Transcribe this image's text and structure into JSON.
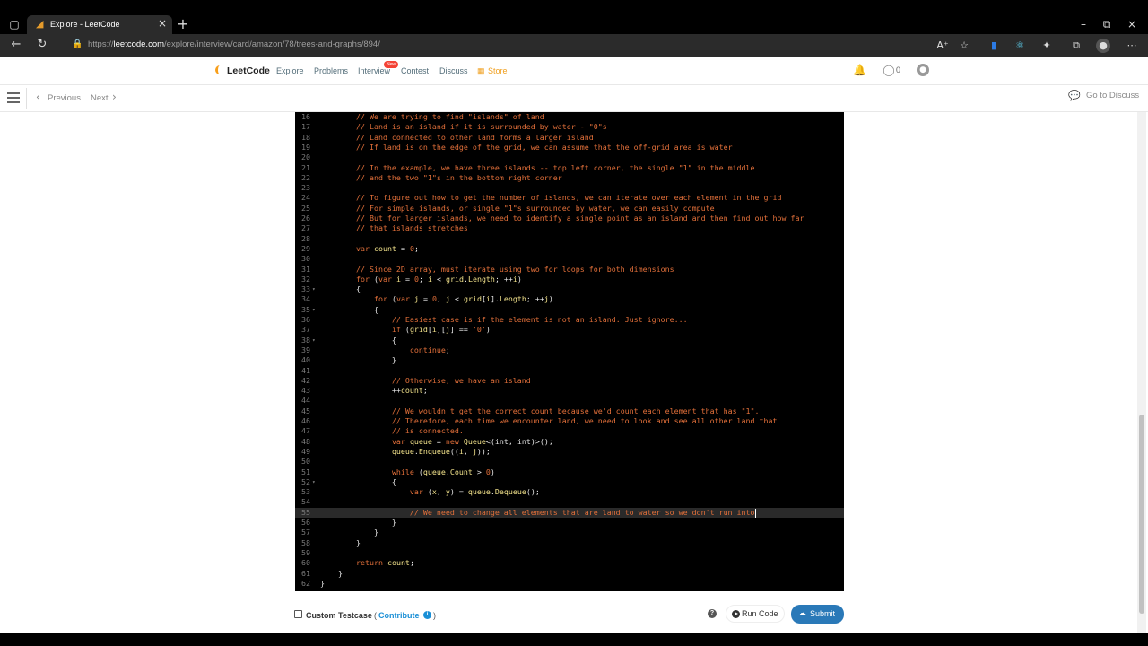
{
  "browser": {
    "tab_title": "Explore - LeetCode",
    "url_prefix": "https://",
    "url_host": "leetcode.com",
    "url_path": "/explore/interview/card/amazon/78/trees-and-graphs/894/"
  },
  "header": {
    "logo_text": "LeetCode",
    "nav": [
      "Explore",
      "Problems",
      "Interview",
      "Contest",
      "Discuss",
      "Store"
    ],
    "new_badge": "New",
    "count": "0"
  },
  "subbar": {
    "previous_label": "Previous",
    "next_label": "Next",
    "go_discuss_label": "Go to Discuss"
  },
  "editor": {
    "active_line": 55,
    "lines": [
      {
        "n": "16",
        "t": "        // We are trying to find \"islands\" of land"
      },
      {
        "n": "17",
        "t": "        // Land is an island if it is surrounded by water - \"0\"s"
      },
      {
        "n": "18",
        "t": "        // Land connected to other land forms a larger island"
      },
      {
        "n": "19",
        "t": "        // If land is on the edge of the grid, we can assume that the off-grid area is water"
      },
      {
        "n": "20",
        "t": ""
      },
      {
        "n": "21",
        "t": "        // In the example, we have three islands -- top left corner, the single \"1\" in the middle"
      },
      {
        "n": "22",
        "t": "        // and the two \"1\"s in the bottom right corner"
      },
      {
        "n": "23",
        "t": ""
      },
      {
        "n": "24",
        "t": "        // To figure out how to get the number of islands, we can iterate over each element in the grid"
      },
      {
        "n": "25",
        "t": "        // For simple islands, or single \"1\"s surrounded by water, we can easily compute"
      },
      {
        "n": "26",
        "t": "        // But for larger islands, we need to identify a single point as an island and then find out how far"
      },
      {
        "n": "27",
        "t": "        // that islands stretches"
      },
      {
        "n": "28",
        "t": ""
      },
      {
        "n": "29",
        "t": "        var count = 0;"
      },
      {
        "n": "30",
        "t": ""
      },
      {
        "n": "31",
        "t": "        // Since 2D array, must iterate using two for loops for both dimensions"
      },
      {
        "n": "32",
        "t": "        for (var i = 0; i < grid.Length; ++i)"
      },
      {
        "n": "33",
        "t": "        {",
        "fold": true
      },
      {
        "n": "34",
        "t": "            for (var j = 0; j < grid[i].Length; ++j)"
      },
      {
        "n": "35",
        "t": "            {",
        "fold": true
      },
      {
        "n": "36",
        "t": "                // Easiest case is if the element is not an island. Just ignore..."
      },
      {
        "n": "37",
        "t": "                if (grid[i][j] == '0')"
      },
      {
        "n": "38",
        "t": "                {",
        "fold": true
      },
      {
        "n": "39",
        "t": "                    continue;"
      },
      {
        "n": "40",
        "t": "                }"
      },
      {
        "n": "41",
        "t": ""
      },
      {
        "n": "42",
        "t": "                // Otherwise, we have an island"
      },
      {
        "n": "43",
        "t": "                ++count;"
      },
      {
        "n": "44",
        "t": ""
      },
      {
        "n": "45",
        "t": "                // We wouldn't get the correct count because we'd count each element that has \"1\"."
      },
      {
        "n": "46",
        "t": "                // Therefore, each time we encounter land, we need to look and see all other land that"
      },
      {
        "n": "47",
        "t": "                // is connected."
      },
      {
        "n": "48",
        "t": "                var queue = new Queue<(int, int)>();"
      },
      {
        "n": "49",
        "t": "                queue.Enqueue((i, j));"
      },
      {
        "n": "50",
        "t": ""
      },
      {
        "n": "51",
        "t": "                while (queue.Count > 0)"
      },
      {
        "n": "52",
        "t": "                {",
        "fold": true
      },
      {
        "n": "53",
        "t": "                    var (x, y) = queue.Dequeue();"
      },
      {
        "n": "54",
        "t": ""
      },
      {
        "n": "55",
        "t": "                    // We need to change all elements that are land to water so we don't run into"
      },
      {
        "n": "56",
        "t": "                }"
      },
      {
        "n": "57",
        "t": "            }"
      },
      {
        "n": "58",
        "t": "        }"
      },
      {
        "n": "59",
        "t": ""
      },
      {
        "n": "60",
        "t": "        return count;"
      },
      {
        "n": "61",
        "t": "    }"
      },
      {
        "n": "62",
        "t": "}"
      }
    ]
  },
  "bottom": {
    "custom_testcase_label": "Custom Testcase",
    "contribute_open": "(",
    "contribute_label": "Contribute",
    "contribute_close": ")",
    "run_code_label": "Run Code",
    "submit_label": "Submit"
  },
  "colors": {
    "comment": "#e3703a",
    "keyword": "#e3703a",
    "identifier": "#f4e48c",
    "number": "#e3703a",
    "plain": "#e8e8e8",
    "submit_bg": "#2a79b8",
    "store": "#f0a020"
  },
  "icons": [
    "window-icon",
    "favicon-icon",
    "close-icon",
    "plus-icon",
    "back-icon",
    "refresh-icon",
    "lock-icon",
    "read-aloud-icon",
    "favorite-icon",
    "extension-icon",
    "collections-icon",
    "profile-icon",
    "more-icon",
    "bell-icon",
    "fire-icon",
    "user-icon",
    "hamburger-icon",
    "chevron-left-icon",
    "chevron-right-icon",
    "chat-icon",
    "info-icon",
    "help-icon",
    "play-icon",
    "cloud-upload-icon"
  ]
}
